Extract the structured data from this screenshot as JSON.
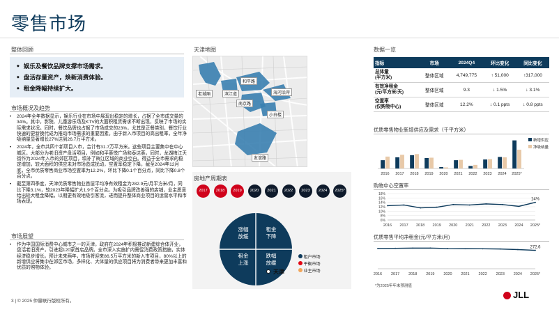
{
  "page_title": "零售市场",
  "summary": {
    "label": "整体回顾",
    "points": [
      "娱乐及餐饮品牌支撑市场需求。",
      "盘活存量资产，焕新消费体验。",
      "租金降幅持续扩大。"
    ]
  },
  "overview": {
    "label": "市场概况及趋势",
    "paragraphs": [
      "2024年全年数据显示，娱乐行业在市场中展现出稳定的增长，占据了全市成交量的34%。其中，影院、儿童游乐场及KTV的大面积租赁需求不断出现，反映了市场的实际需求状况。同时，餐饮品牌也占据了市场成交的23%，尤其是正餐类别，餐饮行业快速的更新换代成为推动市场需求的重要因素。由于新入市项目的高出租率，全年净吸纳量显著增长27%达到26.7万平方米。",
      "2024年，全市共四个新项目入市，合计有31.7万平方米。这些项目主要集中在中心城区，大部分为老旧资产盘活项目，例如和平荟悦广场和泰达荟。同时，龙湖梅江天街作为2024年入市的郊区项目，填补了梅江区域的商业空白。得益于全市需求的稳定增加，较大面积的供应未对市场造成扰动，空置率稳定下降，截至2024年12月底，全市优质零售商业市场空置率为12.2%，环比下降0.1个百分点，同比下降0.8个百分点。",
      "截至第四季度，天津优质零售物业首层平均净有效租金为282.9元/月平方米/月，同比下降3.1%，较2023年降幅扩大1.9个百分点。为吸引品牌改善强的店铺，业主愿意给出较大租金降幅，以期更有效地吸引客流，进而提升整体商业项目的运营水平和市场表现。"
    ]
  },
  "outlook": {
    "label": "市场展望",
    "paragraph": "作为中国国际消费中心城市之一的天津，政府在2024年积极推动新建综合体开业，盘活老旧资产，引进超120家首店品牌。全市深入实施扩内需促消费政策措施，实体经济稳步增长。预计未来两年，市场将迎来86.5万平方米的新入市项目，80%以上的新增供应将集中在郊区市场，多样化、大体量的供应项目将为消费者带来更加丰富和优质的购物体验。"
  },
  "map": {
    "label": "天津地图",
    "districts": [
      "和平路",
      "老城厢",
      "滨江道",
      "海河沿岸",
      "南京路",
      "小白楼",
      "友谊路"
    ]
  },
  "cycle": {
    "label": "房地产周期表",
    "years": [
      "2017",
      "2018",
      "2019",
      "2020",
      "2021",
      "2022",
      "2023",
      "2024",
      "2025*"
    ],
    "quadrants": [
      "涨幅放缓",
      "租金下降",
      "租金上涨",
      "跌幅放缓"
    ],
    "city": "天津",
    "legend": [
      {
        "label": "租户市场",
        "color": "#0e3b5c"
      },
      {
        "label": "平衡市场",
        "color": "#e30613"
      },
      {
        "label": "业主市场",
        "color": "#f2a65a"
      }
    ],
    "year_colors": [
      "#d0021b",
      "#d0021b",
      "#d0021b",
      "#0e1a2b",
      "#0e1a2b",
      "#0e1a2b",
      "#0e1a2b",
      "#0e1a2b",
      "#0e1a2b"
    ]
  },
  "table": {
    "label": "数据一览",
    "headers": [
      "指标",
      "市场",
      "2024Q4",
      "环比变化",
      "同比变化"
    ],
    "rows": [
      {
        "metric": "总体量\n(平方米)",
        "market": "整体区域",
        "value": "4,749,775",
        "qoq": "↑ 51,000",
        "yoy": "↑317,000"
      },
      {
        "metric": "有效净租金\n(元/平方米/天)",
        "market": "整体区域",
        "value": "9.3",
        "qoq": "↓ 1.5%",
        "yoy": "↓ 3.1%"
      },
      {
        "metric": "空置率\n(仅购物中心)",
        "market": "整体区域",
        "value": "12.2%",
        "qoq": "↓ 0.1 ppts",
        "yoy": "↓ 0.8 ppts"
      }
    ]
  },
  "chart_data": [
    {
      "type": "bar",
      "title": "优质零售物业新增供应及需求（千平方米）",
      "categories": [
        "2016",
        "2017",
        "2018",
        "2019",
        "2020",
        "2021",
        "2022",
        "2023",
        "2024",
        "2025*"
      ],
      "series": [
        {
          "name": "新增供应",
          "color": "#0e3b5c",
          "values": [
            230,
            310,
            370,
            290,
            40,
            230,
            70,
            250,
            320,
            780
          ]
        },
        {
          "name": "净吸纳量",
          "color": "#e8c9a8",
          "values": [
            330,
            380,
            400,
            300,
            30,
            240,
            100,
            260,
            310,
            520
          ]
        }
      ],
      "ylim": [
        0,
        850
      ],
      "legend": "right"
    },
    {
      "type": "line",
      "title": "购物中心空置率",
      "categories": [
        "2016",
        "2017",
        "2018",
        "2019",
        "2020",
        "2021",
        "2022",
        "2023",
        "2024",
        "2025*"
      ],
      "series": [
        {
          "name": "空置率",
          "color": "#0e3b5c",
          "values": [
            12.5,
            12.8,
            11.5,
            11.8,
            13.0,
            12.8,
            13.3,
            13.0,
            12.2,
            14.0
          ]
        }
      ],
      "y_ticks": [
        "6%",
        "8%",
        "10%",
        "12%",
        "14%",
        "16%",
        "18%"
      ],
      "ylim": [
        6,
        18
      ],
      "end_label": "14%"
    },
    {
      "type": "line",
      "title": "优质零售平均净租金(元/平方米/月)",
      "categories": [
        "2016",
        "2017",
        "2018",
        "2019",
        "2020",
        "2021",
        "2022",
        "2023",
        "2024",
        "2025*"
      ],
      "series": [
        {
          "name": "租金",
          "color": "#0e3b5c",
          "values": [
            300,
            302,
            305,
            306,
            298,
            296,
            295,
            292,
            283,
            272.6
          ]
        }
      ],
      "ylim": [
        0,
        350
      ],
      "end_label": "272.6",
      "note": "*为2025年年末预测值"
    }
  ],
  "footer": {
    "text": "3  |  © 2025 仲量联行版权所有。",
    "logo": "JLL"
  }
}
